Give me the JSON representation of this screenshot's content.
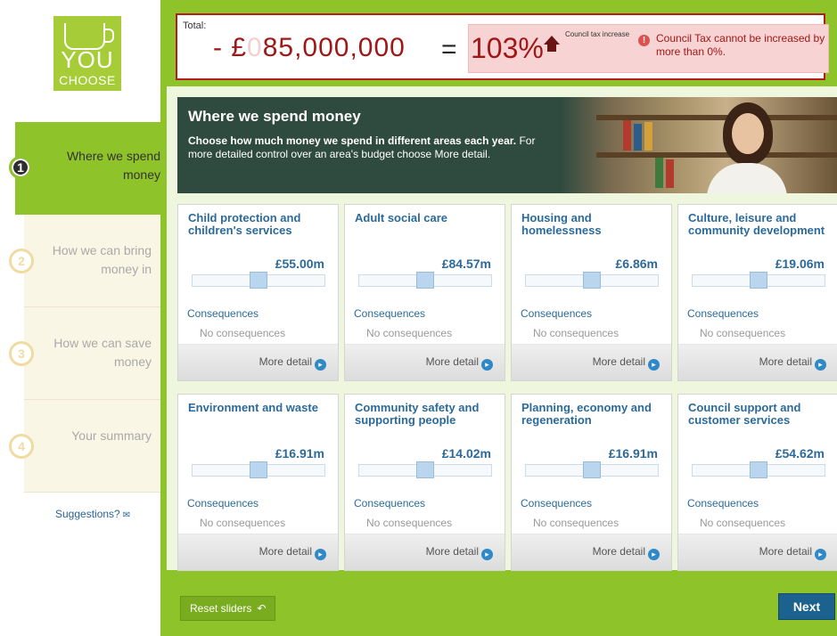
{
  "logo": {
    "line1": "YOU",
    "line2": "CHOOSE"
  },
  "steps": [
    {
      "num": "1",
      "label": "Where we spend money",
      "active": true
    },
    {
      "num": "2",
      "label": "How we can bring money in",
      "active": false
    },
    {
      "num": "3",
      "label": "How we can save money",
      "active": false
    },
    {
      "num": "4",
      "label": "Your summary",
      "active": false
    }
  ],
  "suggestions": "Suggestions?",
  "total": {
    "label": "Total:",
    "amount_prefix": "- £",
    "amount_ghost": "0",
    "amount": "85,000,000",
    "equals": "=",
    "percent": "103%",
    "council_tax_label": "Council tax increase",
    "warning": "Council Tax cannot be increased by more than 0%."
  },
  "hero": {
    "title": "Where we spend money",
    "text_bold": "Choose how much money we spend in different areas each year.",
    "text_rest": " For more detailed control over an area's budget choose More detail."
  },
  "cards": [
    {
      "title": "Child protection and children's services",
      "amount": "£55.00m",
      "slider": 0.5,
      "consequences_label": "Consequences",
      "consequences": "No consequences",
      "more": "More detail"
    },
    {
      "title": "Adult social care",
      "amount": "£84.57m",
      "slider": 0.5,
      "consequences_label": "Consequences",
      "consequences": "No consequences",
      "more": "More detail"
    },
    {
      "title": "Housing and homelessness",
      "amount": "£6.86m",
      "slider": 0.5,
      "consequences_label": "Consequences",
      "consequences": "No consequences",
      "more": "More detail"
    },
    {
      "title": "Culture, leisure and community development",
      "amount": "£19.06m",
      "slider": 0.5,
      "consequences_label": "Consequences",
      "consequences": "No consequences",
      "more": "More detail"
    },
    {
      "title": "Environment and waste",
      "amount": "£16.91m",
      "slider": 0.5,
      "consequences_label": "Consequences",
      "consequences": "No consequences",
      "more": "More detail"
    },
    {
      "title": "Community safety and supporting people",
      "amount": "£14.02m",
      "slider": 0.5,
      "consequences_label": "Consequences",
      "consequences": "No consequences",
      "more": "More detail"
    },
    {
      "title": "Planning, economy and regeneration",
      "amount": "£16.91m",
      "slider": 0.5,
      "consequences_label": "Consequences",
      "consequences": "No consequences",
      "more": "More detail"
    },
    {
      "title": "Council support and customer services",
      "amount": "£54.62m",
      "slider": 0.5,
      "consequences_label": "Consequences",
      "consequences": "No consequences",
      "more": "More detail"
    }
  ],
  "buttons": {
    "reset": "Reset sliders",
    "next": "Next"
  },
  "colors": {
    "brand_green": "#8ec32a",
    "warning_red": "#a11717",
    "link_blue": "#2b6a9a",
    "next_blue": "#1b628f"
  }
}
